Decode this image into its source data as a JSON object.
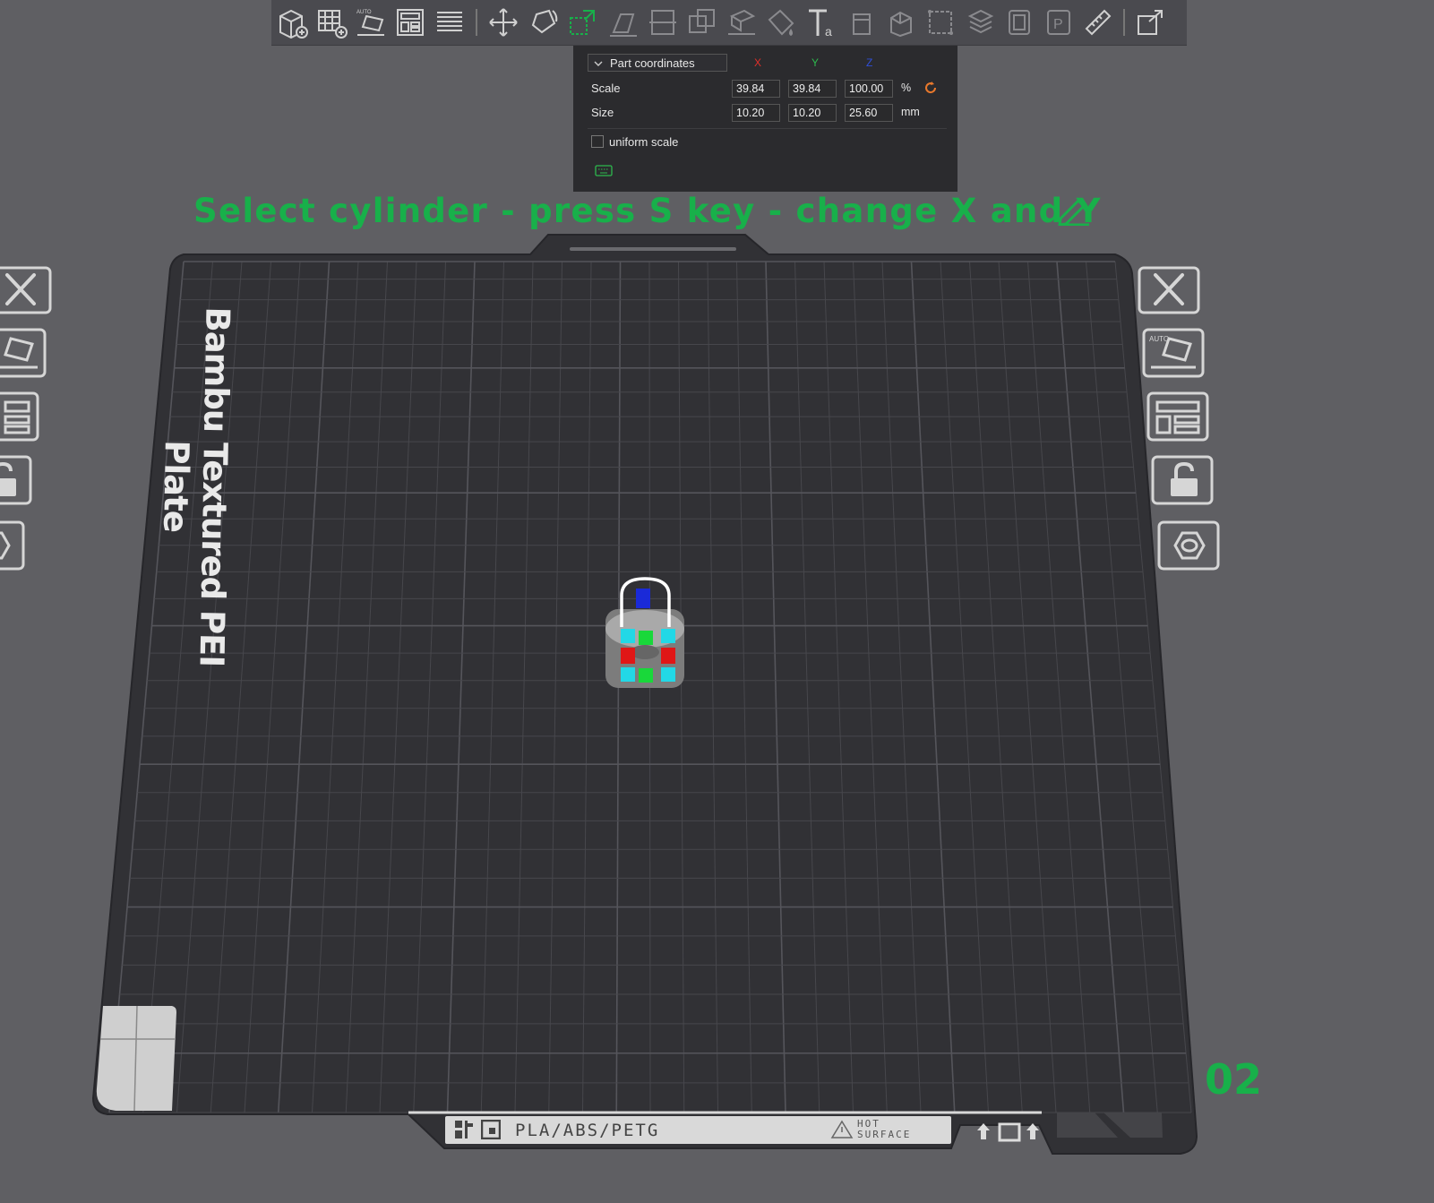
{
  "toolbar": {
    "tools": [
      {
        "name": "add-object-icon"
      },
      {
        "name": "add-plate-icon"
      },
      {
        "name": "auto-orient-icon"
      },
      {
        "name": "arrange-icon"
      },
      {
        "name": "split-objects-icon"
      },
      {
        "name": "move-icon"
      },
      {
        "name": "rotate-icon"
      },
      {
        "name": "scale-icon",
        "active": true
      },
      {
        "name": "lay-on-face-icon"
      },
      {
        "name": "cut-icon"
      },
      {
        "name": "boolean-icon"
      },
      {
        "name": "support-paint-icon"
      },
      {
        "name": "color-paint-icon"
      },
      {
        "name": "text-icon"
      },
      {
        "name": "seam-paint-icon"
      },
      {
        "name": "fuzzy-skin-icon"
      },
      {
        "name": "mesh-boolean-icon"
      },
      {
        "name": "variable-layer-icon"
      },
      {
        "name": "assembly-icon"
      },
      {
        "name": "emboss-icon"
      },
      {
        "name": "measure-icon"
      },
      {
        "name": "export-icon"
      }
    ]
  },
  "panel": {
    "coord_system": "Part coordinates",
    "axis_x": "X",
    "axis_y": "Y",
    "axis_z": "Z",
    "scale_label": "Scale",
    "scale_x": "39.84",
    "scale_y": "39.84",
    "scale_z": "100.00",
    "scale_unit": "%",
    "size_label": "Size",
    "size_x": "10.20",
    "size_y": "10.20",
    "size_z": "25.60",
    "size_unit": "mm",
    "uniform_scale_label": "uniform scale",
    "uniform_scale_checked": false
  },
  "instruction": "Select cylinder - press S key - change X and Y",
  "plate": {
    "name": "Bambu Textured PEI Plate",
    "number": "02",
    "material": "PLA/ABS/PETG",
    "hot_line1": "HOT",
    "hot_line2": "SURFACE"
  },
  "colors": {
    "accent_green": "#18b04a",
    "axis_x": "#e0302a",
    "axis_y": "#2db84d",
    "axis_z": "#2f4fd8",
    "reset_orange": "#e8782c"
  }
}
